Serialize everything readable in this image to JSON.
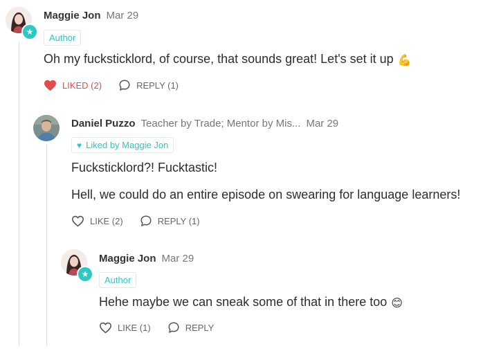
{
  "comments": [
    {
      "author": "Maggie Jon",
      "date": "Mar 29",
      "tag": "Author",
      "text": "Oh my fucksticklord, of course, that sounds great! Let's set it up",
      "emoji": "💪",
      "like_label": "LIKED (2)",
      "reply_label": "REPLY (1)"
    },
    {
      "author": "Daniel Puzzo",
      "bio": "Teacher by Trade; Mentor by Mis...",
      "date": "Mar 29",
      "tag": "Liked by Maggie Jon",
      "text1": "Fucksticklord?! Fucktastic!",
      "text2": "Hell, we could do an entire episode on swearing for language learners!",
      "like_label": "LIKE (2)",
      "reply_label": "REPLY (1)"
    },
    {
      "author": "Maggie Jon",
      "date": "Mar 29",
      "tag": "Author",
      "text": "Hehe maybe we can sneak some of that in there too",
      "emoji": "😊",
      "like_label": "LIKE (1)",
      "reply_label": "REPLY"
    }
  ],
  "colors": {
    "accent": "#2fc7c4",
    "liked": "#e24b4b",
    "muted": "#777777"
  },
  "icons": [
    "heart-filled-icon",
    "heart-outline-icon",
    "reply-bubble-icon",
    "star-icon"
  ]
}
